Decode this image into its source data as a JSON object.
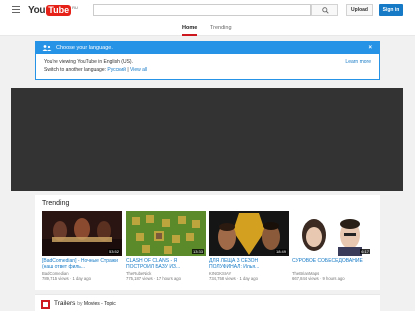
{
  "header": {
    "logo_you": "You",
    "logo_tube": "Tube",
    "logo_region": "RU",
    "search_placeholder": "",
    "upload_label": "Upload",
    "signin_label": "Sign in"
  },
  "tabs": [
    {
      "label": "Home",
      "active": true
    },
    {
      "label": "Trending",
      "active": false
    }
  ],
  "language_banner": {
    "title": "Choose your language.",
    "line1": "You're viewing YouTube in English (US).",
    "line2_prefix": "Switch to another language:",
    "language_option": "Русский",
    "separator": "|",
    "view_all": "View all",
    "learn_more": "Learn more",
    "close": "×"
  },
  "trending": {
    "title": "Trending",
    "videos": [
      {
        "title": "[BadComedian] - Ночные Стражи (наш ответ филь...",
        "channel": "BadComedian",
        "views": "789,715 views",
        "age": "1 day ago",
        "duration": "53:52",
        "thumb_colors": [
          "#3a1a1a",
          "#8b2a1a",
          "#c8a060"
        ]
      },
      {
        "title": "CLASH OF CLANS - Я ПОСТРОИЛ БАЗУ ИЗ...",
        "channel": "TheRubeNick",
        "views": "775,187 views",
        "age": "17 hours ago",
        "duration": "13:33",
        "thumb_colors": [
          "#4a7a2a",
          "#6a9a3a",
          "#c8a840"
        ]
      },
      {
        "title": "ДЛЯ ЛЕЩА 3 СЕЗОН ПОЛУФИНАЛ: Илья...",
        "channel": "KINGKSIAY",
        "views": "734,758 views",
        "age": "1 day ago",
        "duration": "18:49",
        "thumb_colors": [
          "#1a1a1a",
          "#d4a020",
          "#8a5a3a"
        ]
      },
      {
        "title": "СУРОВОЕ СОБЕСЕДОВАНИЕ",
        "channel": "TheBrianMaps",
        "views": "667,844 views",
        "age": "9 hours ago",
        "duration": "6:17",
        "thumb_colors": [
          "#ffffff",
          "#2a2a2a",
          "#e8c8b0"
        ]
      }
    ]
  },
  "trailers": {
    "title": "Trailers",
    "by_prefix": "by",
    "by_channel": "Movies - Topic"
  },
  "colors": {
    "accent_red": "#e62117",
    "blue": "#2793e6",
    "link": "#167ac6"
  }
}
